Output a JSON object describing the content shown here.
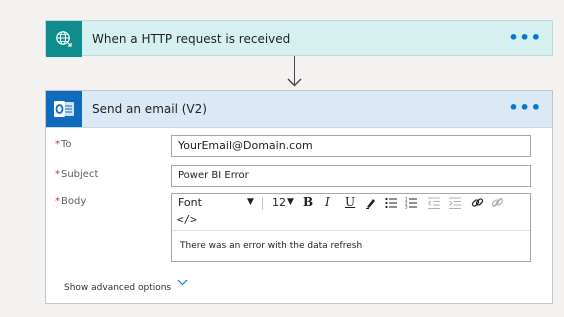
{
  "trigger": {
    "title": "When a HTTP request is received",
    "icon": "globe-request-icon",
    "more": "•••",
    "accent": "#0f8d8d"
  },
  "action": {
    "title": "Send an email (V2)",
    "icon": "outlook-icon",
    "more": "•••",
    "accent": "#0f6cbd",
    "fields": {
      "to": {
        "label": "To",
        "value": "YourEmail@Domain.com"
      },
      "subject": {
        "label": "Subject",
        "value": "Power BI Error"
      },
      "body": {
        "label": "Body",
        "font": "Font",
        "size": "12",
        "code": "</>",
        "value": "There was an error with the data refresh"
      }
    },
    "advanced_label": "Show advanced options"
  },
  "colors": {
    "required": "#d13438",
    "link": "#0078d4"
  }
}
